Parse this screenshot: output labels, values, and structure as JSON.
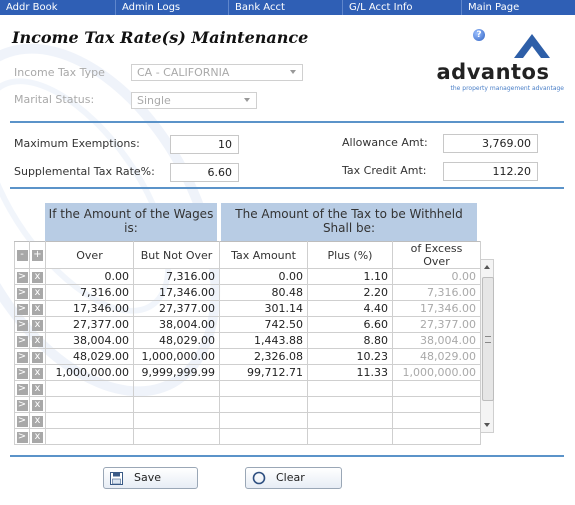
{
  "nav": [
    {
      "label": "Addr Book"
    },
    {
      "label": "Admin Logs"
    },
    {
      "label": "Bank Acct"
    },
    {
      "label": "G/L Acct Info"
    },
    {
      "label": "Main Page"
    }
  ],
  "page": {
    "title": "Income Tax Rate(s) Maintenance"
  },
  "logo": {
    "name": "advantos",
    "tagline": "the property management advantage"
  },
  "filters": {
    "income_tax_type_label": "Income Tax Type",
    "income_tax_type_value": "CA - CALIFORNIA",
    "marital_status_label": "Marital Status:",
    "marital_status_value": "Single"
  },
  "fields": {
    "max_exemptions_label": "Maximum Exemptions:",
    "max_exemptions_value": "10",
    "supplemental_rate_label": "Supplemental Tax Rate%:",
    "supplemental_rate_value": "6.60",
    "allowance_label": "Allowance Amt:",
    "allowance_value": "3,769.00",
    "tax_credit_label": "Tax Credit Amt:",
    "tax_credit_value": "112.20"
  },
  "table": {
    "group_left": "If the Amount of the Wages is:",
    "group_right": "The Amount of the Tax to be Withheld Shall be:",
    "columns": [
      "Over",
      "But Not Over",
      "Tax Amount",
      "Plus (%)",
      "of Excess Over"
    ],
    "rows": [
      [
        "0.00",
        "7,316.00",
        "0.00",
        "1.10",
        "0.00"
      ],
      [
        "7,316.00",
        "17,346.00",
        "80.48",
        "2.20",
        "7,316.00"
      ],
      [
        "17,346.00",
        "27,377.00",
        "301.14",
        "4.40",
        "17,346.00"
      ],
      [
        "27,377.00",
        "38,004.00",
        "742.50",
        "6.60",
        "27,377.00"
      ],
      [
        "38,004.00",
        "48,029.00",
        "1,443.88",
        "8.80",
        "38,004.00"
      ],
      [
        "48,029.00",
        "1,000,000.00",
        "2,326.08",
        "10.23",
        "48,029.00"
      ],
      [
        "1,000,000.00",
        "9,999,999.99",
        "99,712.71",
        "11.33",
        "1,000,000.00"
      ],
      [
        "",
        "",
        "",
        "",
        ""
      ],
      [
        "",
        "",
        "",
        "",
        ""
      ],
      [
        "",
        "",
        "",
        "",
        ""
      ],
      [
        "",
        "",
        "",
        "",
        ""
      ]
    ]
  },
  "buttons": {
    "save": "Save",
    "clear": "Clear"
  },
  "colors": {
    "nav_bg": "#2f5fb5",
    "header_bg": "#b8cce4",
    "rule": "#5b93c9",
    "logo_mark": "#2e5fa8"
  }
}
